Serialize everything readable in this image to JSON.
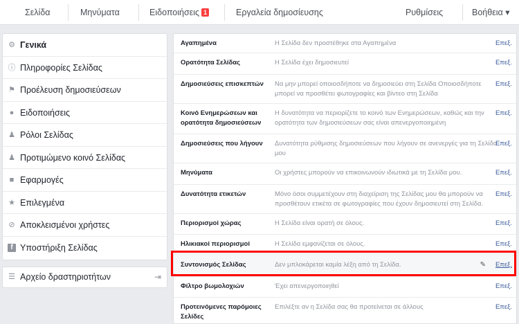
{
  "top_nav": {
    "page": "Σελίδα",
    "messages": "Μηνύματα",
    "notifications": "Ειδοποιήσεις",
    "notifications_badge": "1",
    "publishing_tools": "Εργαλεία δημοσίευσης",
    "settings": "Ρυθμίσεις",
    "help": "Βοήθεια ▾"
  },
  "sidebar": {
    "items": [
      {
        "label": "Γενικά",
        "icon": "gear-icon"
      },
      {
        "label": "Πληροφορίες Σελίδας",
        "icon": "info-icon"
      },
      {
        "label": "Προέλευση δημοσιεύσεων",
        "icon": "flag-icon"
      },
      {
        "label": "Ειδοποιήσεις",
        "icon": "globe-icon"
      },
      {
        "label": "Ρόλοι Σελίδας",
        "icon": "person-icon"
      },
      {
        "label": "Προτιμώμενο κοινό Σελίδας",
        "icon": "person-add-icon"
      },
      {
        "label": "Εφαρμογές",
        "icon": "cube-icon"
      },
      {
        "label": "Επιλεγμένα",
        "icon": "star-icon"
      },
      {
        "label": "Αποκλεισμένοι χρήστες",
        "icon": "block-icon"
      },
      {
        "label": "Υποστήριξη Σελίδας",
        "icon": "facebook-icon"
      }
    ],
    "activity_log": "Αρχείο δραστηριοτήτων"
  },
  "settings": {
    "edit_label": "Επεξ.",
    "rows": [
      {
        "name": "Αγαπημένα",
        "description": "Η Σελίδα δεν προστέθηκε στα Αγαπημένα"
      },
      {
        "name": "Ορατότητα Σελίδας",
        "description": "Η Σελίδα έχει δημοσιευτεί"
      },
      {
        "name": "Δημοσιεύσεις επισκεπτών",
        "description": "Να μην μπορεί οποιοσδήποτε να δημοσιεύει στη Σελίδα Οποιοσδήποτε μπορεί να προσθέτει φωτογραφίες και βίντεο στη Σελίδα"
      },
      {
        "name": "Κοινό Ενημερώσεων και ορατότητα δημοσιεύσεων",
        "description": "Η δυνατότητα να περιορίζετε το κοινό των Ενημερώσεων, καθώς και την ορατότητα των δημοσιεύσεων σας είναι απενεργοποιημένη"
      },
      {
        "name": "Δημοσιεύσεις που λήγουν",
        "description": "Δυνατότητα ρύθμισης δημοσιεύσεων που λήγουν σε ανενεργές για τη Σελίδα μου"
      },
      {
        "name": "Μηνύματα",
        "description": "Οι χρήστες μπορούν να επικοινωνούν ιδιωτικά με τη Σελίδα μου."
      },
      {
        "name": "Δυνατότητα ετικετών",
        "description": "Μόνο όσοι συμμετέχουν στη διαχείριση της Σελίδας μου θα μπορούν να προσθέτουν ετικέτα σε φωτογραφίες που έχουν δημοσιευτεί στη Σελίδα."
      },
      {
        "name": "Περιορισμοί χώρας",
        "description": "Η Σελίδα είναι ορατή σε όλους."
      },
      {
        "name": "Ηλικιακοί περιορισμοί",
        "description": "Η Σελίδα εμφανίζεται σε όλους."
      },
      {
        "name": "Συντονισμός Σελίδας",
        "description": "Δεν μπλοκάρεται καμία λέξη από τη Σελίδα."
      },
      {
        "name": "Φίλτρο βωμολοχιών",
        "description": "Έχει απενεργοποιηθεί"
      },
      {
        "name": "Προτεινόμενες παρόμοιες Σελίδες",
        "description": "Επιλέξτε αν η Σελίδα σας θα προτείνεται σε άλλους"
      }
    ]
  },
  "colors": {
    "highlight": "#ff0000",
    "link": "#365899",
    "badge": "#fa3e3e"
  }
}
